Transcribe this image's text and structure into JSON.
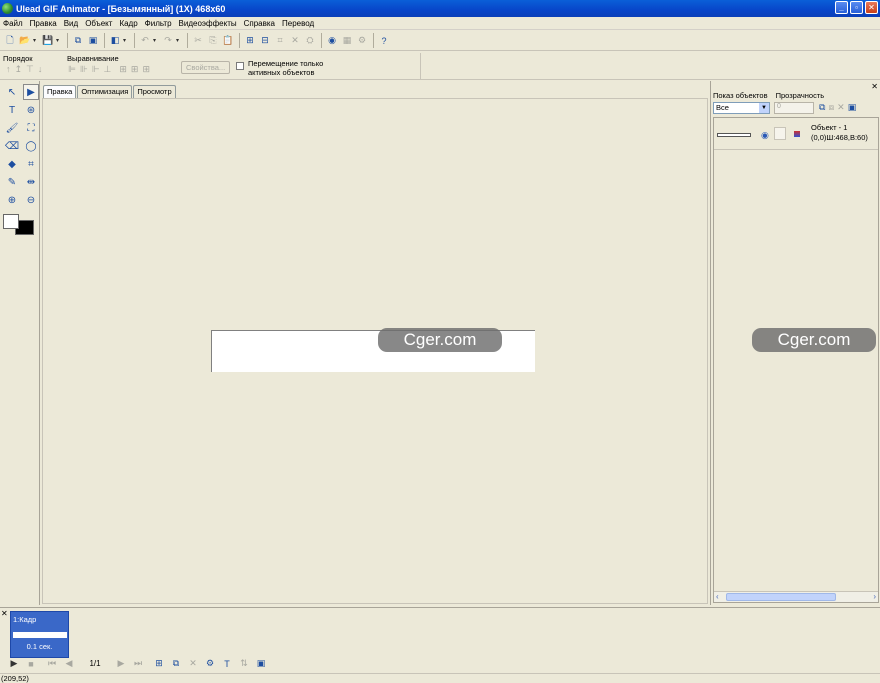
{
  "window": {
    "title": "Ulead GIF Animator - [Безымянный] (1X) 468x60"
  },
  "menu": [
    "Файл",
    "Правка",
    "Вид",
    "Объект",
    "Кадр",
    "Фильтр",
    "Видеоэффекты",
    "Справка",
    "Перевод"
  ],
  "options": {
    "order_label": "Порядок",
    "align_label": "Выравнивание",
    "properties_label": "Свойства...",
    "move_active_line1": "Перемещение только",
    "move_active_line2": "активных объектов"
  },
  "tabs": [
    "Правка",
    "Оптимизация",
    "Просмотр"
  ],
  "watermark": "Cger.com",
  "objects_panel": {
    "show_label": "Показ объектов",
    "transparency_label": "Прозрачность",
    "filter_value": "Все",
    "opacity_value": "0",
    "object_name": "Объект - 1",
    "object_info": "(0,0)Ш:468,В:60)"
  },
  "frames": {
    "frame_label": "1:Кадр",
    "frame_time": "0.1 сек.",
    "frame_counter": "1/1"
  },
  "status": {
    "coords": "(209,52)"
  }
}
